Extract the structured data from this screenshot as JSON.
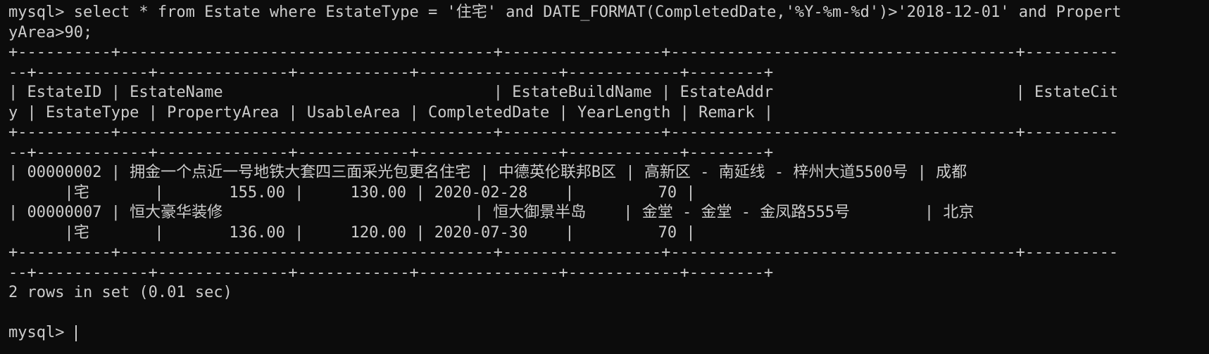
{
  "terminal": {
    "lines": [
      "mysql> select * from Estate where EstateType = '住宅' and DATE_FORMAT(CompletedDate,'%Y-%m-%d')>'2018-12-01' and Propert",
      "yArea>90;",
      "+----------+----------------------------------------+-----------------+-------------------------------------+----------",
      "--+------------+--------------+------------+---------------+------------+--------+",
      "| EstateID | EstateName                             | EstateBuildName | EstateAddr                          | EstateCit",
      "y | EstateType | PropertyArea | UsableArea | CompletedDate | YearLength | Remark |",
      "+----------+----------------------------------------+-----------------+-------------------------------------+----------",
      "--+------------+--------------+------------+---------------+------------+--------+",
      "| 00000002 | 拥金一个点近一号地铁大套四三面采光包更名住宅 | 中德英伦联邦B区 | 高新区 - 南延线 - 梓州大道5500号 | 成都",
      "      |宅       |       155.00 |     130.00 | 2020-02-28    |         70 |",
      "| 00000007 | 恒大豪华装修                           | 恒大御景半岛    | 金堂 - 金堂 - 金凤路555号        | 北京",
      "      |宅       |       136.00 |     120.00 | 2020-07-30    |         70 |",
      "+----------+----------------------------------------+-----------------+-------------------------------------+----------",
      "--+------------+--------------+------------+---------------+------------+--------+",
      "2 rows in set (0.01 sec)",
      "",
      "mysql> "
    ]
  }
}
